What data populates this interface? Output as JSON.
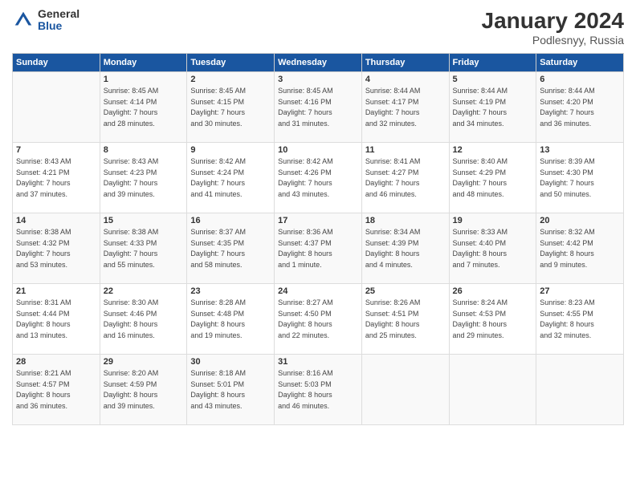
{
  "header": {
    "logo_general": "General",
    "logo_blue": "Blue",
    "month_title": "January 2024",
    "location": "Podlesnyy, Russia"
  },
  "weekdays": [
    "Sunday",
    "Monday",
    "Tuesday",
    "Wednesday",
    "Thursday",
    "Friday",
    "Saturday"
  ],
  "weeks": [
    [
      {
        "day": "",
        "details": ""
      },
      {
        "day": "1",
        "details": "Sunrise: 8:45 AM\nSunset: 4:14 PM\nDaylight: 7 hours\nand 28 minutes."
      },
      {
        "day": "2",
        "details": "Sunrise: 8:45 AM\nSunset: 4:15 PM\nDaylight: 7 hours\nand 30 minutes."
      },
      {
        "day": "3",
        "details": "Sunrise: 8:45 AM\nSunset: 4:16 PM\nDaylight: 7 hours\nand 31 minutes."
      },
      {
        "day": "4",
        "details": "Sunrise: 8:44 AM\nSunset: 4:17 PM\nDaylight: 7 hours\nand 32 minutes."
      },
      {
        "day": "5",
        "details": "Sunrise: 8:44 AM\nSunset: 4:19 PM\nDaylight: 7 hours\nand 34 minutes."
      },
      {
        "day": "6",
        "details": "Sunrise: 8:44 AM\nSunset: 4:20 PM\nDaylight: 7 hours\nand 36 minutes."
      }
    ],
    [
      {
        "day": "7",
        "details": "Sunrise: 8:43 AM\nSunset: 4:21 PM\nDaylight: 7 hours\nand 37 minutes."
      },
      {
        "day": "8",
        "details": "Sunrise: 8:43 AM\nSunset: 4:23 PM\nDaylight: 7 hours\nand 39 minutes."
      },
      {
        "day": "9",
        "details": "Sunrise: 8:42 AM\nSunset: 4:24 PM\nDaylight: 7 hours\nand 41 minutes."
      },
      {
        "day": "10",
        "details": "Sunrise: 8:42 AM\nSunset: 4:26 PM\nDaylight: 7 hours\nand 43 minutes."
      },
      {
        "day": "11",
        "details": "Sunrise: 8:41 AM\nSunset: 4:27 PM\nDaylight: 7 hours\nand 46 minutes."
      },
      {
        "day": "12",
        "details": "Sunrise: 8:40 AM\nSunset: 4:29 PM\nDaylight: 7 hours\nand 48 minutes."
      },
      {
        "day": "13",
        "details": "Sunrise: 8:39 AM\nSunset: 4:30 PM\nDaylight: 7 hours\nand 50 minutes."
      }
    ],
    [
      {
        "day": "14",
        "details": "Sunrise: 8:38 AM\nSunset: 4:32 PM\nDaylight: 7 hours\nand 53 minutes."
      },
      {
        "day": "15",
        "details": "Sunrise: 8:38 AM\nSunset: 4:33 PM\nDaylight: 7 hours\nand 55 minutes."
      },
      {
        "day": "16",
        "details": "Sunrise: 8:37 AM\nSunset: 4:35 PM\nDaylight: 7 hours\nand 58 minutes."
      },
      {
        "day": "17",
        "details": "Sunrise: 8:36 AM\nSunset: 4:37 PM\nDaylight: 8 hours\nand 1 minute."
      },
      {
        "day": "18",
        "details": "Sunrise: 8:34 AM\nSunset: 4:39 PM\nDaylight: 8 hours\nand 4 minutes."
      },
      {
        "day": "19",
        "details": "Sunrise: 8:33 AM\nSunset: 4:40 PM\nDaylight: 8 hours\nand 7 minutes."
      },
      {
        "day": "20",
        "details": "Sunrise: 8:32 AM\nSunset: 4:42 PM\nDaylight: 8 hours\nand 9 minutes."
      }
    ],
    [
      {
        "day": "21",
        "details": "Sunrise: 8:31 AM\nSunset: 4:44 PM\nDaylight: 8 hours\nand 13 minutes."
      },
      {
        "day": "22",
        "details": "Sunrise: 8:30 AM\nSunset: 4:46 PM\nDaylight: 8 hours\nand 16 minutes."
      },
      {
        "day": "23",
        "details": "Sunrise: 8:28 AM\nSunset: 4:48 PM\nDaylight: 8 hours\nand 19 minutes."
      },
      {
        "day": "24",
        "details": "Sunrise: 8:27 AM\nSunset: 4:50 PM\nDaylight: 8 hours\nand 22 minutes."
      },
      {
        "day": "25",
        "details": "Sunrise: 8:26 AM\nSunset: 4:51 PM\nDaylight: 8 hours\nand 25 minutes."
      },
      {
        "day": "26",
        "details": "Sunrise: 8:24 AM\nSunset: 4:53 PM\nDaylight: 8 hours\nand 29 minutes."
      },
      {
        "day": "27",
        "details": "Sunrise: 8:23 AM\nSunset: 4:55 PM\nDaylight: 8 hours\nand 32 minutes."
      }
    ],
    [
      {
        "day": "28",
        "details": "Sunrise: 8:21 AM\nSunset: 4:57 PM\nDaylight: 8 hours\nand 36 minutes."
      },
      {
        "day": "29",
        "details": "Sunrise: 8:20 AM\nSunset: 4:59 PM\nDaylight: 8 hours\nand 39 minutes."
      },
      {
        "day": "30",
        "details": "Sunrise: 8:18 AM\nSunset: 5:01 PM\nDaylight: 8 hours\nand 43 minutes."
      },
      {
        "day": "31",
        "details": "Sunrise: 8:16 AM\nSunset: 5:03 PM\nDaylight: 8 hours\nand 46 minutes."
      },
      {
        "day": "",
        "details": ""
      },
      {
        "day": "",
        "details": ""
      },
      {
        "day": "",
        "details": ""
      }
    ]
  ]
}
